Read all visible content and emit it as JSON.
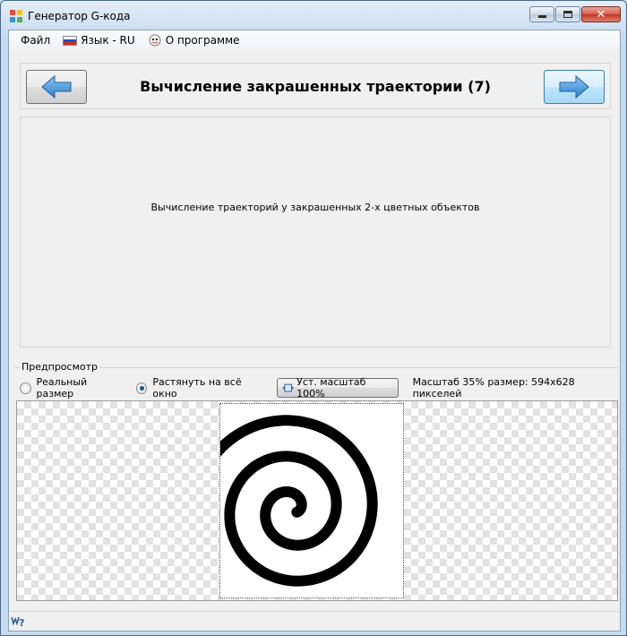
{
  "window": {
    "title": "Генератор G-кода",
    "close_glyph": "✕"
  },
  "menu": {
    "file": "Файл",
    "language": "Язык - RU",
    "about": "О программе"
  },
  "step": {
    "title": "Вычисление закрашенных траектории (7)",
    "description": "Вычисление траекторий у закрашенных 2-х цветных объектов"
  },
  "preview": {
    "group_label": "Предпросмотр",
    "radio_real": "Реальный размер",
    "radio_stretch": "Растянуть на всё окно",
    "selected_option": "radio_stretch",
    "scale_button": "Уст. масштаб 100%",
    "scale_info": "Масштаб 35% размер: 594x628 пикселей",
    "scale_percent": 35,
    "image_width": 594,
    "image_height": 628
  },
  "colors": {
    "arrow_blue": "#3a8fd6",
    "spiral": "#000000"
  },
  "icons": {
    "prev": "arrow-left-icon",
    "next": "arrow-right-icon",
    "help": "help-icon"
  }
}
